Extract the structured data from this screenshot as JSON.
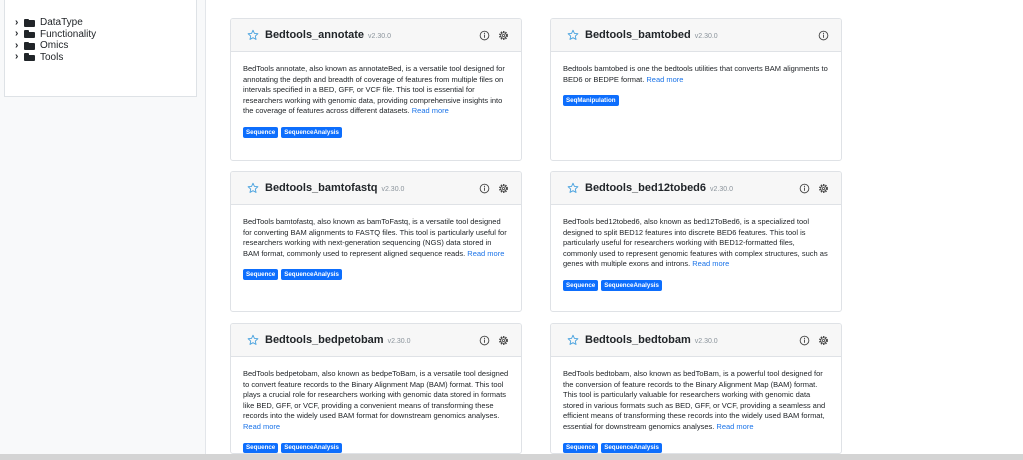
{
  "sidebar": {
    "items": [
      {
        "label": "DataType"
      },
      {
        "label": "Functionality"
      },
      {
        "label": "Omics"
      },
      {
        "label": "Tools"
      }
    ]
  },
  "cards": [
    {
      "title": "Bedtools_annotate",
      "version": "v2.30.0",
      "description": "BedTools annotate, also known as annotateBed, is a versatile tool designed for annotating the depth and breadth of coverage of features from multiple files on intervals specified in a BED, GFF, or VCF file. This tool is essential for researchers working with genomic data, providing comprehensive insights into the coverage of features across different datasets.",
      "read_more": "Read more",
      "tags": [
        "Sequence",
        "SequenceAnalysis"
      ]
    },
    {
      "title": "Bedtools_bamtobed",
      "version": "v2.30.0",
      "description": "Bedtools bamtobed is one the bedtools utilities that converts BAM alignments to BED6 or BEDPE format.",
      "read_more": "Read more",
      "tags": [
        "SeqManipulation"
      ]
    },
    {
      "title": "Bedtools_bamtofastq",
      "version": "v2.30.0",
      "description": "BedTools bamtofastq, also known as bamToFastq, is a versatile tool designed for converting BAM alignments to FASTQ files. This tool is particularly useful for researchers working with next-generation sequencing (NGS) data stored in BAM format, commonly used to represent aligned sequence reads.",
      "read_more": "Read more",
      "tags": [
        "Sequence",
        "SequenceAnalysis"
      ]
    },
    {
      "title": "Bedtools_bed12tobed6",
      "version": "v2.30.0",
      "description": "BedTools bed12tobed6, also known as bed12ToBed6, is a specialized tool designed to split BED12 features into discrete BED6 features. This tool is particularly useful for researchers working with BED12-formatted files, commonly used to represent genomic features with complex structures, such as genes with multiple exons and introns.",
      "read_more": "Read more",
      "tags": [
        "Sequence",
        "SequenceAnalysis"
      ]
    },
    {
      "title": "Bedtools_bedpetobam",
      "version": "v2.30.0",
      "description": "BedTools bedpetobam, also known as bedpeToBam, is a versatile tool designed to convert feature records to the Binary Alignment Map (BAM) format. This tool plays a crucial role for researchers working with genomic data stored in formats like BED, GFF, or VCF, providing a convenient means of transforming these records into the widely used BAM format for downstream genomics analyses.",
      "read_more": "Read more",
      "tags": [
        "Sequence",
        "SequenceAnalysis"
      ]
    },
    {
      "title": "Bedtools_bedtobam",
      "version": "v2.30.0",
      "description": "BedTools bedtobam, also known as bedToBam, is a powerful tool designed for the conversion of feature records to the Binary Alignment Map (BAM) format. This tool is particularly valuable for researchers working with genomic data stored in various formats such as BED, GFF, or VCF, providing a seamless and efficient means of transforming these records into the widely used BAM format, essential for downstream genomics analyses.",
      "read_more": "Read more",
      "tags": [
        "Sequence",
        "SequenceAnalysis"
      ]
    }
  ],
  "icons": {
    "star": "star-outline-icon",
    "info": "info-circle-icon",
    "settings": "gear-icon",
    "folder": "folder-icon",
    "chevron": "chevron-right-icon"
  },
  "colors": {
    "accent": "#0d6efd",
    "link": "#1a73e8",
    "star": "#4aa3df"
  }
}
